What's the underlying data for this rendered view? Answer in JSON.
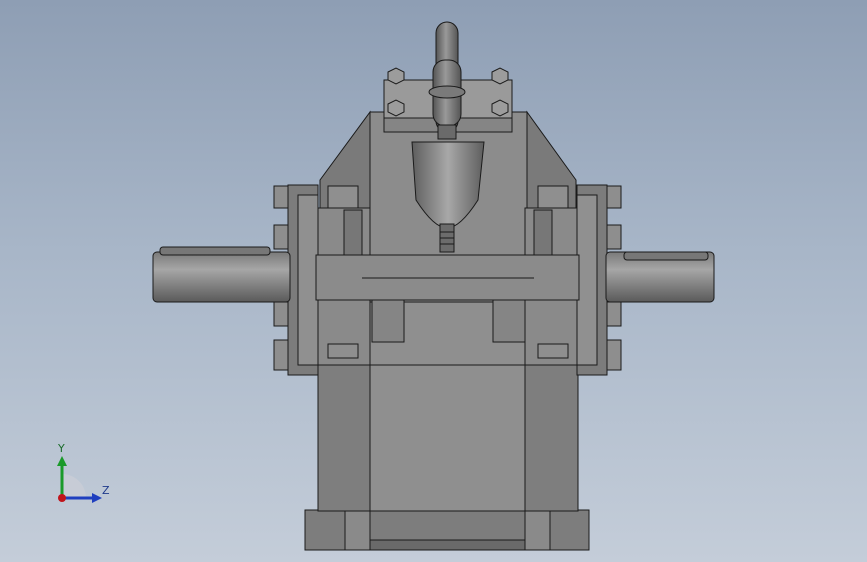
{
  "viewport": {
    "background_top": "#8e9eb4",
    "background_bottom": "#c4cdd9"
  },
  "model": {
    "description_icon": "gearbox-model-icon",
    "body_color": "#8c8c8c",
    "edge_color": "#1a1a1a"
  },
  "triad": {
    "y_label": "Y",
    "z_label": "Z",
    "y_color": "#1a9a2a",
    "z_color": "#1f3fbf",
    "x_color": "#c0141b"
  }
}
